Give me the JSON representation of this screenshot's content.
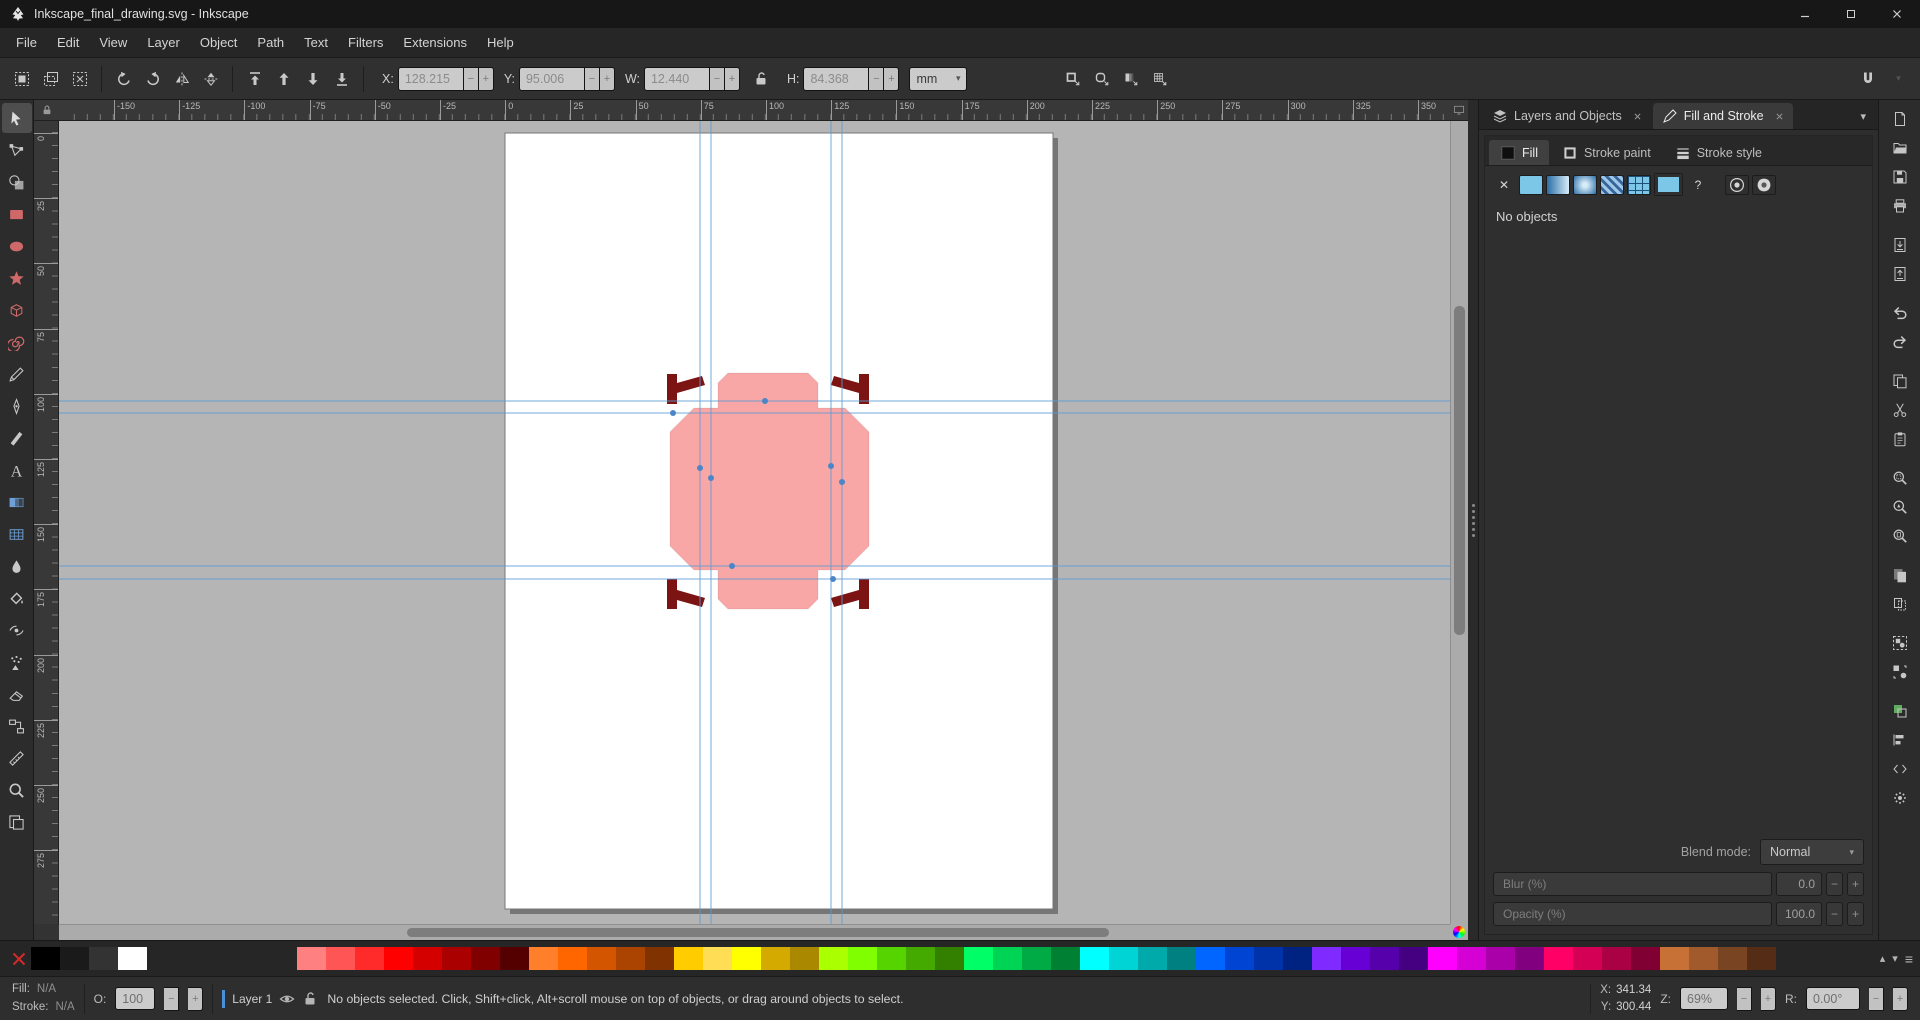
{
  "window": {
    "title": "Inkscape_final_drawing.svg - Inkscape"
  },
  "menubar": {
    "items": [
      "File",
      "Edit",
      "View",
      "Layer",
      "Object",
      "Path",
      "Text",
      "Filters",
      "Extensions",
      "Help"
    ]
  },
  "icons": {
    "chevron_down": "▾",
    "minus": "−",
    "plus": "+",
    "up_small": "▴",
    "down_small": "▾",
    "menu_glyph": "≡",
    "question": "?",
    "cross": "✕"
  },
  "theme": {
    "accent": "#4a90d9",
    "desk": "#b5b5b5",
    "page": "#ffffff",
    "shape_fill": "#f9a6a6",
    "bracket": "#7d1414",
    "guide": "#5b9bd5",
    "handle": "#4a86c8"
  },
  "tool_controls": {
    "select_buttons": [
      {
        "name": "select-all",
        "icon": "select-all"
      },
      {
        "name": "select-all-layers",
        "icon": "select-layers"
      },
      {
        "name": "deselect",
        "icon": "deselect"
      }
    ],
    "transform_buttons": [
      {
        "name": "rotate-ccw",
        "icon": "rotate-ccw"
      },
      {
        "name": "rotate-cw",
        "icon": "rotate-cw"
      },
      {
        "name": "flip-horizontal",
        "icon": "flip-h"
      },
      {
        "name": "flip-vertical",
        "icon": "flip-v"
      }
    ],
    "zorder_buttons": [
      {
        "name": "raise-to-top",
        "icon": "raise-top"
      },
      {
        "name": "raise",
        "icon": "raise"
      },
      {
        "name": "lower",
        "icon": "lower"
      },
      {
        "name": "lower-to-bottom",
        "icon": "lower-bottom"
      }
    ],
    "fields": [
      {
        "key": "x",
        "label": "X:",
        "value": "128.215",
        "disabled": true
      },
      {
        "key": "y",
        "label": "Y:",
        "value": "95.006",
        "disabled": true
      },
      {
        "key": "w",
        "label": "W:",
        "value": "12.440",
        "disabled": true
      },
      {
        "key": "h",
        "label": "H:",
        "value": "84.368",
        "disabled": true
      }
    ],
    "unit": "mm",
    "option_buttons": [
      {
        "name": "scale-stroke-toggle",
        "icon": "scale-stroke"
      },
      {
        "name": "scale-corners-toggle",
        "icon": "scale-corners"
      },
      {
        "name": "move-gradients-toggle",
        "icon": "move-gradients"
      },
      {
        "name": "move-patterns-toggle",
        "icon": "move-patterns"
      }
    ]
  },
  "toolbox": {
    "tools": [
      {
        "name": "selector",
        "icon": "select-tool",
        "color": "#dcdcdc",
        "active": true
      },
      {
        "name": "node-editor",
        "icon": "node-tool",
        "color": "#c9c9c9"
      },
      {
        "name": "shape-builder",
        "icon": "shape-builder-tool",
        "color": "#c9c9c9"
      },
      {
        "name": "rectangle",
        "icon": "rect-tool",
        "color": "#cf6868"
      },
      {
        "name": "ellipse",
        "icon": "ellipse-tool",
        "color": "#cf6868"
      },
      {
        "name": "star",
        "icon": "star-tool",
        "color": "#cf6868"
      },
      {
        "name": "box-3d",
        "icon": "box3d-tool",
        "color": "#cf6868"
      },
      {
        "name": "spiral",
        "icon": "spiral-tool",
        "color": "#cf6868"
      },
      {
        "name": "pencil",
        "icon": "pencil-tool",
        "color": "#c9c9c9"
      },
      {
        "name": "bezier-pen",
        "icon": "pen-tool",
        "color": "#c9c9c9"
      },
      {
        "name": "calligraphy",
        "icon": "calligraphy-tool",
        "color": "#c9c9c9"
      },
      {
        "name": "text",
        "icon": "text-tool",
        "color": "#c9c9c9"
      },
      {
        "name": "gradient",
        "icon": "gradient-tool",
        "color": "#6fa1d8"
      },
      {
        "name": "mesh-gradient",
        "icon": "mesh-tool",
        "color": "#6fa1d8"
      },
      {
        "name": "dropper",
        "icon": "dropper-tool",
        "color": "#c9c9c9"
      },
      {
        "name": "paint-bucket",
        "icon": "bucket-tool",
        "color": "#c9c9c9"
      },
      {
        "name": "tweak",
        "icon": "tweak-tool",
        "color": "#c9c9c9"
      },
      {
        "name": "spray",
        "icon": "spray-tool",
        "color": "#c9c9c9"
      },
      {
        "name": "eraser",
        "icon": "eraser-tool",
        "color": "#c9c9c9"
      },
      {
        "name": "connector",
        "icon": "connector-tool",
        "color": "#c9c9c9"
      },
      {
        "name": "measure",
        "icon": "measure-tool",
        "color": "#c9c9c9"
      },
      {
        "name": "zoom",
        "icon": "zoom-tool",
        "color": "#c9c9c9"
      },
      {
        "name": "pages",
        "icon": "pages-tool",
        "color": "#c9c9c9"
      }
    ]
  },
  "rulers": {
    "horizontal_labels": [
      "-150",
      "-125",
      "-100",
      "-75",
      "-50",
      "-25",
      "0",
      "25",
      "50",
      "75",
      "100",
      "125",
      "150",
      "175",
      "200",
      "225",
      "250",
      "275",
      "300",
      "325",
      "350"
    ],
    "vertical_labels": [
      "0",
      "25",
      "50",
      "75",
      "100",
      "125",
      "150",
      "175",
      "200",
      "225",
      "250",
      "275"
    ]
  },
  "canvas": {
    "unit": "mm",
    "vertical_guides_mm": [
      75,
      79,
      125,
      129
    ],
    "horizontal_guides_mm": [
      103,
      107,
      166,
      171
    ]
  },
  "dock": {
    "tabs": [
      {
        "name": "tab-layers-objects",
        "label": "Layers and Objects",
        "icon": "layers"
      },
      {
        "name": "tab-fill-stroke",
        "label": "Fill and Stroke",
        "icon": "fill-stroke",
        "active": true
      }
    ],
    "fill_stroke": {
      "tabs": [
        {
          "name": "fill-tab",
          "label": "Fill",
          "icon": "fill-swatch",
          "active": true
        },
        {
          "name": "stroke-paint-tab",
          "label": "Stroke paint",
          "icon": "stroke-swatch"
        },
        {
          "name": "stroke-style-tab",
          "label": "Stroke style",
          "icon": "stroke-style"
        }
      ],
      "paint_buttons": [
        {
          "name": "paint-none",
          "type": "none"
        },
        {
          "name": "paint-flat-color",
          "type": "flat"
        },
        {
          "name": "paint-linear-gradient",
          "type": "linear"
        },
        {
          "name": "paint-radial-gradient",
          "type": "radial"
        },
        {
          "name": "paint-pattern",
          "type": "pattern"
        },
        {
          "name": "paint-mesh-gradient",
          "type": "mesh"
        },
        {
          "name": "paint-swatch",
          "type": "swatch"
        },
        {
          "name": "paint-unknown",
          "type": "unknown"
        },
        {
          "name": "fill-rule-nonzero",
          "type": "rule-nz",
          "gap": true
        },
        {
          "name": "fill-rule-evenodd",
          "type": "rule-eo",
          "active": true
        }
      ],
      "status": "No objects",
      "blend": {
        "label": "Blend mode:",
        "value": "Normal"
      },
      "blur": {
        "label": "Blur (%)",
        "value": "0.0"
      },
      "opacity": {
        "label": "Opacity (%)",
        "value": "100.0"
      }
    }
  },
  "command_bar": {
    "items": [
      {
        "name": "new-document",
        "icon": "new-doc"
      },
      {
        "name": "open-document",
        "icon": "open-doc"
      },
      {
        "name": "save-document",
        "icon": "save-doc"
      },
      {
        "name": "print-document",
        "icon": "print-doc"
      },
      {
        "sep": true
      },
      {
        "name": "import-image",
        "icon": "import-img"
      },
      {
        "name": "export-image",
        "icon": "export-img"
      },
      {
        "sep": true
      },
      {
        "name": "undo",
        "icon": "undo"
      },
      {
        "name": "redo",
        "icon": "redo"
      },
      {
        "sep": true
      },
      {
        "name": "copy",
        "icon": "copy"
      },
      {
        "name": "cut",
        "icon": "cut"
      },
      {
        "name": "paste",
        "icon": "paste"
      },
      {
        "sep": true
      },
      {
        "name": "zoom-to-selection",
        "icon": "zoom-sel"
      },
      {
        "name": "zoom-to-drawing",
        "icon": "zoom-draw"
      },
      {
        "name": "zoom-to-page",
        "icon": "zoom-page"
      },
      {
        "sep": true
      },
      {
        "name": "duplicate",
        "icon": "duplicate"
      },
      {
        "name": "create-clone",
        "icon": "clone"
      },
      {
        "sep": true
      },
      {
        "name": "group",
        "icon": "group-objs"
      },
      {
        "name": "ungroup",
        "icon": "ungroup-objs"
      },
      {
        "sep": true
      },
      {
        "name": "open-fill-stroke",
        "icon": "fill-stroke-dlg"
      },
      {
        "name": "open-align",
        "icon": "align-dlg"
      },
      {
        "name": "open-xml-editor",
        "icon": "xml-editor"
      },
      {
        "name": "open-preferences",
        "icon": "preferences"
      }
    ]
  },
  "palette": {
    "grays": [
      "#000000",
      "#1a1a1a",
      "#333333",
      "#ffffff"
    ],
    "colors": [
      "#ff8080",
      "#ff5555",
      "#ff2a2a",
      "#ff0000",
      "#d40000",
      "#aa0000",
      "#800000",
      "#550000",
      "#ff7f2a",
      "#ff6600",
      "#d45500",
      "#aa4400",
      "#803300",
      "#ffcc00",
      "#ffdd55",
      "#ffff00",
      "#d4aa00",
      "#aa8800",
      "#aaff00",
      "#80ff00",
      "#55d400",
      "#44aa00",
      "#338000",
      "#00ff66",
      "#00d455",
      "#00aa44",
      "#008033",
      "#00ffff",
      "#00d4d4",
      "#00aaaa",
      "#008080",
      "#0066ff",
      "#0044d4",
      "#0033aa",
      "#002280",
      "#7f2aff",
      "#6600d4",
      "#5500aa",
      "#440080",
      "#ff00ff",
      "#d400d4",
      "#aa00aa",
      "#800080",
      "#ff0066",
      "#d40055",
      "#aa0044",
      "#800033",
      "#c87137",
      "#a05a2c",
      "#784421",
      "#552d16"
    ]
  },
  "statusbar": {
    "fill": {
      "label": "Fill:",
      "value": "N/A"
    },
    "stroke": {
      "label": "Stroke:",
      "value": "N/A"
    },
    "opacity": {
      "label": "O:",
      "value": "100"
    },
    "layer": {
      "label": "Layer 1"
    },
    "message": "No objects selected. Click, Shift+click, Alt+scroll mouse on top of objects, or drag around objects to select.",
    "x": {
      "label": "X:",
      "value": "341.34"
    },
    "y": {
      "label": "Y:",
      "value": "300.44"
    },
    "zoom": {
      "label": "Z:",
      "value": "69%"
    },
    "rotation": {
      "label": "R:",
      "value": "0.00°"
    }
  }
}
